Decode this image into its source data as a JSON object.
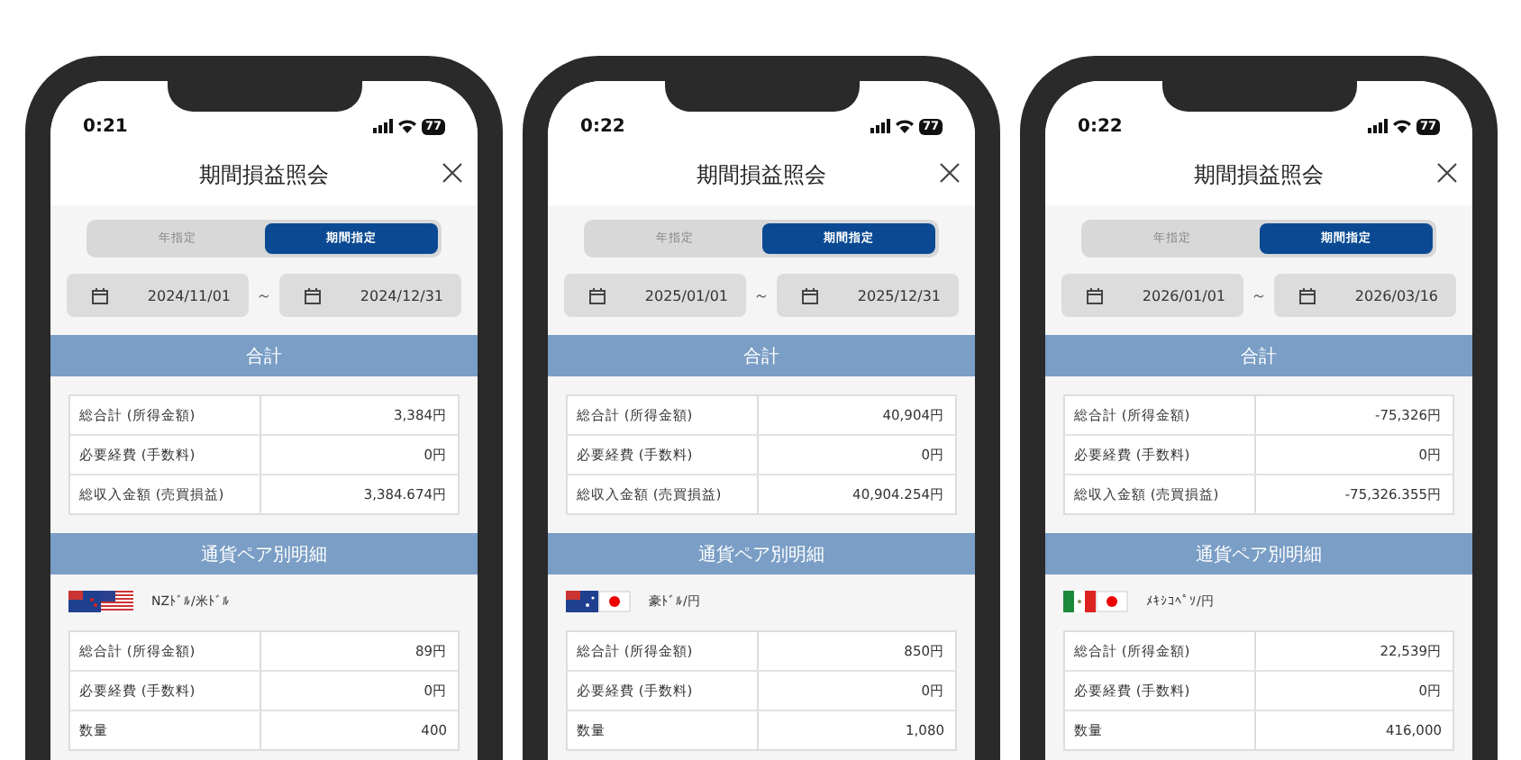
{
  "phones": [
    {
      "status_bar": {
        "time": "0:21",
        "battery": "77"
      },
      "title": "期間損益照会",
      "segments": [
        {
          "label": "年指定",
          "selected": false
        },
        {
          "label": "期間指定",
          "selected": true
        }
      ],
      "date_from": "2024/11/01",
      "date_separator": "～",
      "date_to": "2024/12/31",
      "summary": {
        "heading": "合計",
        "rows": [
          {
            "label": "総合計 (所得金額)",
            "value": "3,384円"
          },
          {
            "label": "必要経費 (手数料)",
            "value": "0円"
          },
          {
            "label": "総収入金額 (売買損益)",
            "value": "3,384.674円"
          }
        ]
      },
      "details": {
        "heading": "通貨ペア別明細",
        "pairs": [
          {
            "name": "NZﾄﾞﾙ/米ﾄﾞﾙ",
            "rows": [
              {
                "label": "総合計 (所得金額)",
                "value": "89円"
              },
              {
                "label": "必要経費 (手数料)",
                "value": "0円"
              },
              {
                "label": "数量",
                "value": "400"
              }
            ]
          }
        ]
      }
    },
    {
      "status_bar": {
        "time": "0:22",
        "battery": "77"
      },
      "title": "期間損益照会",
      "segments": [
        {
          "label": "年指定",
          "selected": false
        },
        {
          "label": "期間指定",
          "selected": true
        }
      ],
      "date_from": "2025/01/01",
      "date_separator": "～",
      "date_to": "2025/12/31",
      "summary": {
        "heading": "合計",
        "rows": [
          {
            "label": "総合計 (所得金額)",
            "value": "40,904円"
          },
          {
            "label": "必要経費 (手数料)",
            "value": "0円"
          },
          {
            "label": "総収入金額 (売買損益)",
            "value": "40,904.254円"
          }
        ]
      },
      "details": {
        "heading": "通貨ペア別明細",
        "pairs": [
          {
            "name": "豪ﾄﾞﾙ/円",
            "rows": [
              {
                "label": "総合計 (所得金額)",
                "value": "850円"
              },
              {
                "label": "必要経費 (手数料)",
                "value": "0円"
              },
              {
                "label": "数量",
                "value": "1,080"
              }
            ]
          }
        ]
      }
    },
    {
      "status_bar": {
        "time": "0:22",
        "battery": "77"
      },
      "title": "期間損益照会",
      "segments": [
        {
          "label": "年指定",
          "selected": false
        },
        {
          "label": "期間指定",
          "selected": true
        }
      ],
      "date_from": "2026/01/01",
      "date_separator": "～",
      "date_to": "2026/03/16",
      "summary": {
        "heading": "合計",
        "rows": [
          {
            "label": "総合計 (所得金額)",
            "value": "-75,326円"
          },
          {
            "label": "必要経費 (手数料)",
            "value": "0円"
          },
          {
            "label": "総収入金額 (売買損益)",
            "value": "-75,326.355円"
          }
        ]
      },
      "details": {
        "heading": "通貨ペア別明細",
        "pairs": [
          {
            "name": "ﾒｷｼｺﾍﾟｿ/円",
            "rows": [
              {
                "label": "総合計 (所得金額)",
                "value": "22,539円"
              },
              {
                "label": "必要経費 (手数料)",
                "value": "0円"
              },
              {
                "label": "数量",
                "value": "416,000"
              }
            ]
          }
        ]
      }
    }
  ]
}
